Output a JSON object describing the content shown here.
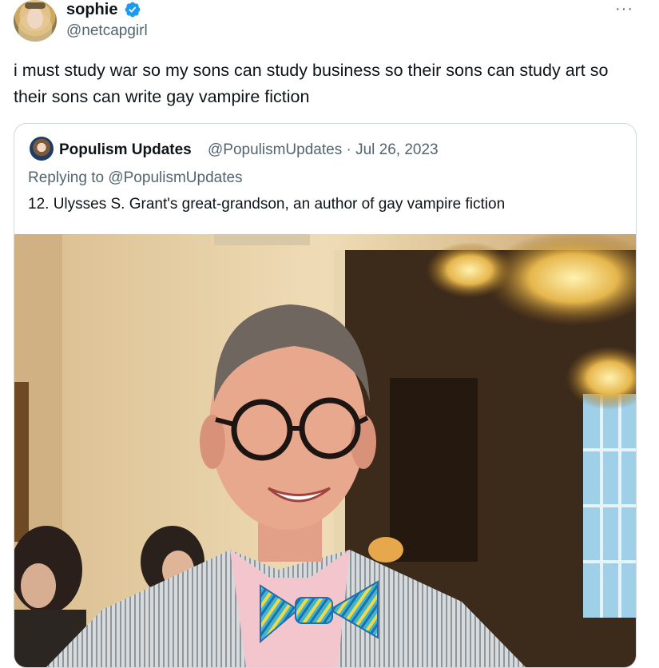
{
  "tweet": {
    "author_name": "sophie",
    "handle": "@netcapgirl",
    "text": "i must study war so my sons can study business so their sons can study art so their sons can write gay vampire fiction",
    "more_label": "···",
    "verified_color": "#1d9bf0"
  },
  "quote": {
    "author_name": "Populism Updates",
    "meta": "@PopulismUpdates · Jul 26, 2023",
    "reply_prefix": "Replying to ",
    "reply_handle": "@PopulismUpdates",
    "text": "12. Ulysses S. Grant's great-grandson, an author of gay vampire fiction"
  },
  "colors": {
    "text_primary": "#0f1419",
    "text_secondary": "#536471",
    "border": "#cfd9de"
  }
}
